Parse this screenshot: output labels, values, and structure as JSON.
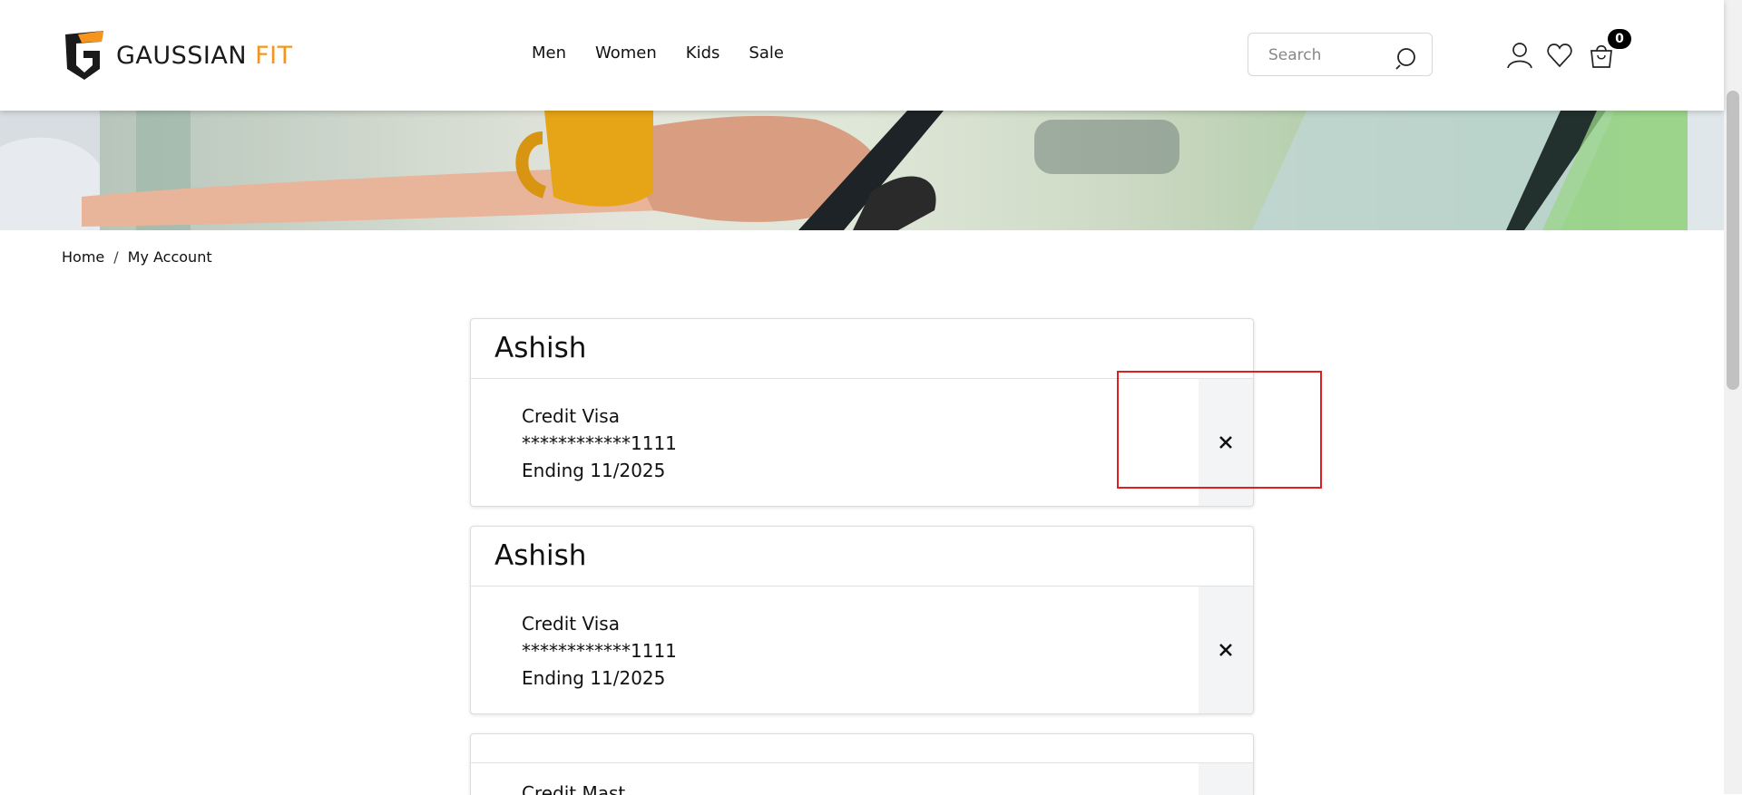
{
  "header": {
    "logo": {
      "brand_primary": "GAUSSIAN",
      "brand_accent": "FIT",
      "accent_color": "#f7941d"
    },
    "nav": [
      {
        "label": "Men"
      },
      {
        "label": "Women"
      },
      {
        "label": "Kids"
      },
      {
        "label": "Sale"
      }
    ],
    "search": {
      "placeholder": "Search",
      "value": ""
    },
    "icons": [
      "user-icon",
      "heart-icon",
      "cart-icon"
    ],
    "cart_count": "0"
  },
  "breadcrumb": {
    "home": "Home",
    "separator": "/",
    "current": "My Account"
  },
  "cards": [
    {
      "name": "Ashish",
      "type": "Credit Visa",
      "number": "************1111",
      "expiry": "Ending 11/2025"
    },
    {
      "name": "Ashish",
      "type": "Credit Visa",
      "number": "************1111",
      "expiry": "Ending 11/2025"
    },
    {
      "name": "",
      "type": "Credit Mast",
      "number": "",
      "expiry": ""
    }
  ],
  "colors": {
    "highlight": "#e02020",
    "delete_bg": "#f3f4f6"
  }
}
